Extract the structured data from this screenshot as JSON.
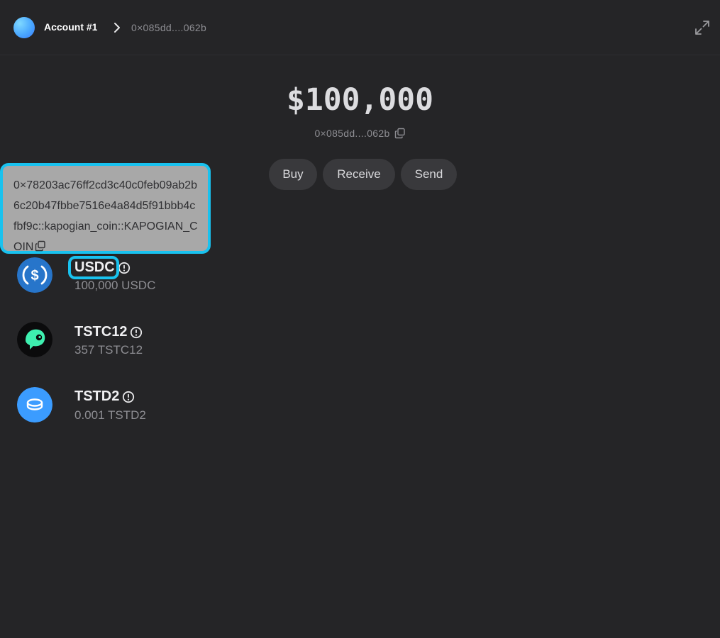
{
  "header": {
    "account_name": "Account #1",
    "address_short": "0×085dd....062b"
  },
  "balance": {
    "total": "$100,000",
    "address_short": "0×085dd....062b"
  },
  "actions": {
    "buy": "Buy",
    "receive": "Receive",
    "send": "Send"
  },
  "tooltip": {
    "full_type": "0×78203ac76ff2cd3c40c0feb09ab2b6c20b47fbbe7516e4a84d5f91bbb4cfbf9c::kapogian_coin::KAPOGIAN_COIN"
  },
  "tokens": [
    {
      "symbol": "USDC",
      "balance": "100,000 USDC",
      "icon": "usdc-icon",
      "color": "#2775ca"
    },
    {
      "symbol": "TSTC12",
      "balance": "357 TSTC12",
      "icon": "tstc12-icon",
      "color": "#3ef0b0"
    },
    {
      "symbol": "TSTD2",
      "balance": "0.001 TSTD2",
      "icon": "coin-icon",
      "color": "#3b9cff"
    }
  ],
  "colors": {
    "background": "#252527",
    "highlight": "#19c2ef",
    "button_bg": "#39393c"
  }
}
